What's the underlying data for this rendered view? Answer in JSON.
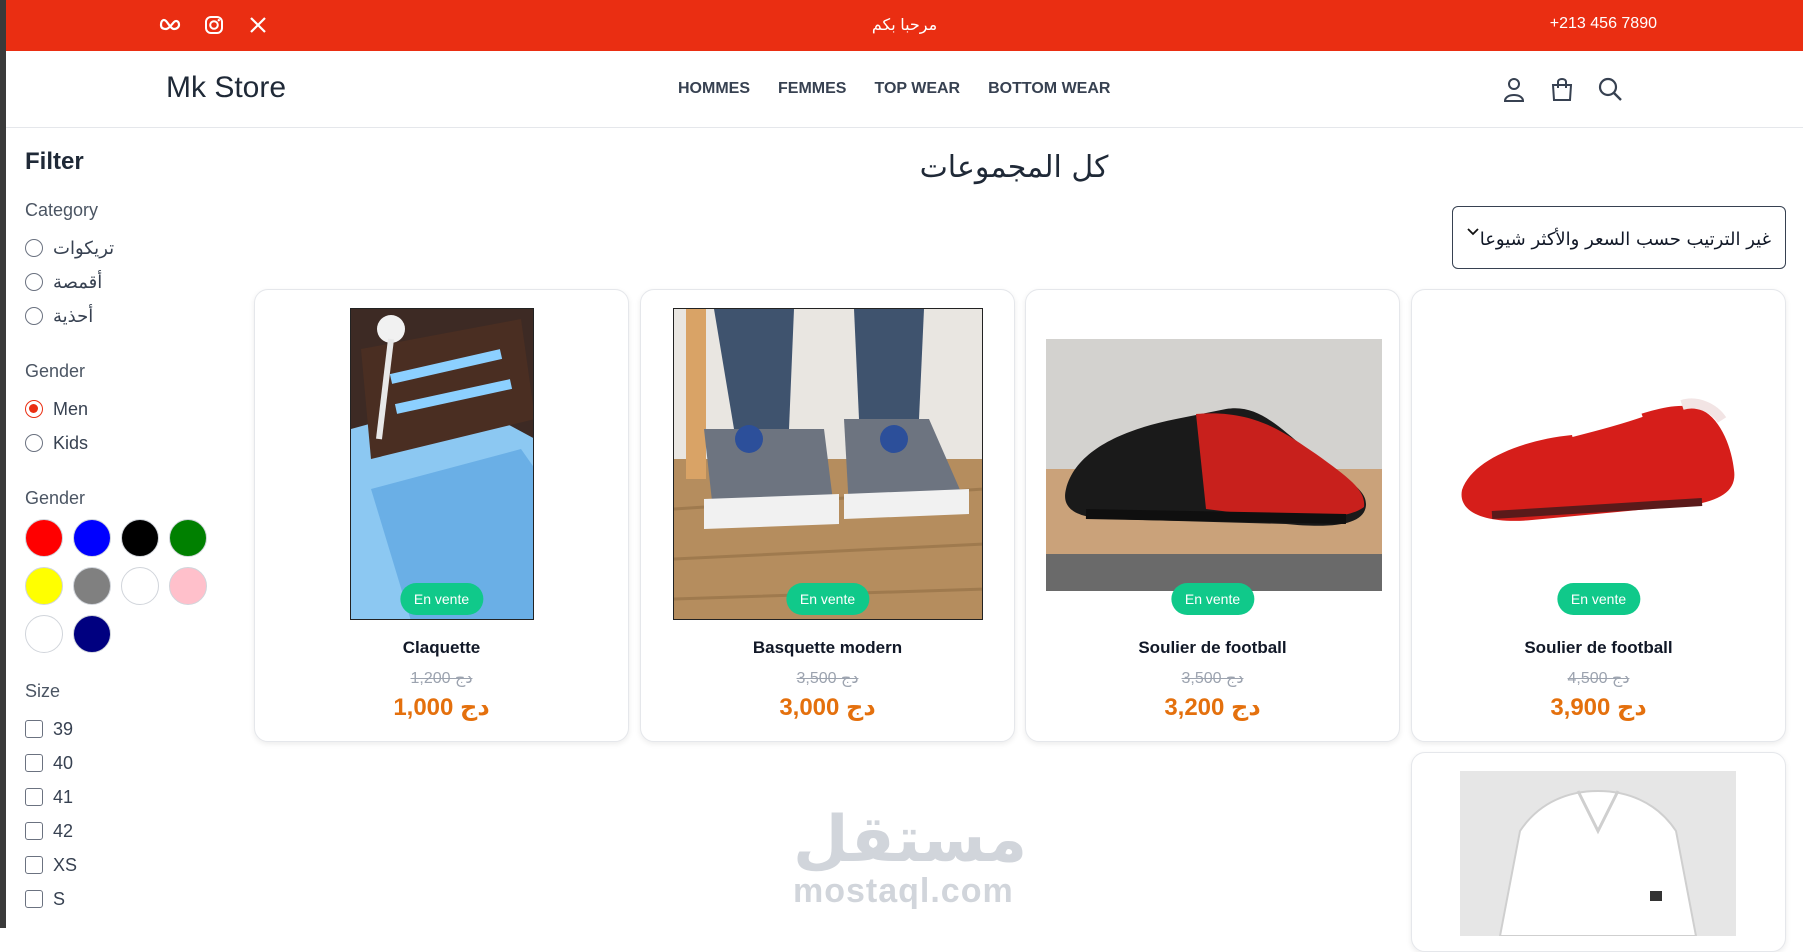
{
  "topbar": {
    "welcome": "مرحبا بكم",
    "phone": "+213 456 7890",
    "socials": [
      "meta-icon",
      "instagram-icon",
      "x-icon"
    ]
  },
  "header": {
    "logo": "Mk Store",
    "nav": [
      "HOMMES",
      "FEMMES",
      "TOP WEAR",
      "BOTTOM WEAR"
    ],
    "icons": [
      "user-icon",
      "shopping-bag-icon",
      "search-icon"
    ]
  },
  "sidebar": {
    "title": "Filter",
    "category": {
      "heading": "Category",
      "options": [
        "تريكوات",
        "أقمصة",
        "أحذية"
      ]
    },
    "gender": {
      "heading": "Gender",
      "options": [
        "Men",
        "Kids"
      ],
      "selected": "Men"
    },
    "colors": {
      "heading": "Gender",
      "swatches": [
        "#ff0000",
        "#0000ff",
        "#000000",
        "#008000",
        "#ffff00",
        "#808080",
        "#ffffff",
        "#ffc0cb",
        "#ffffff",
        "#000080"
      ]
    },
    "size": {
      "heading": "Size",
      "options": [
        "39",
        "40",
        "41",
        "42",
        "XS",
        "S"
      ]
    }
  },
  "main": {
    "title": "كل المجموعات",
    "sort_label": "غير الترتيب حسب السعر والأكثر شيوعا"
  },
  "products": [
    {
      "name": "Claquette",
      "badge": "En vente",
      "old_price": "1,200 دج",
      "price": "1,000 دج"
    },
    {
      "name": "Basquette modern",
      "badge": "En vente",
      "old_price": "3,500 دج",
      "price": "3,000 دج"
    },
    {
      "name": "Soulier de football",
      "badge": "En vente",
      "old_price": "3,500 دج",
      "price": "3,200 دج"
    },
    {
      "name": "Soulier de football",
      "badge": "En vente",
      "old_price": "4,500 دج",
      "price": "3,900 دج"
    }
  ],
  "watermark": {
    "arabic": "مستقل",
    "latin": "mostaql.com"
  },
  "colors": {
    "accent": "#ea2e12",
    "badge": "#10c98a",
    "price": "#e4700d"
  }
}
